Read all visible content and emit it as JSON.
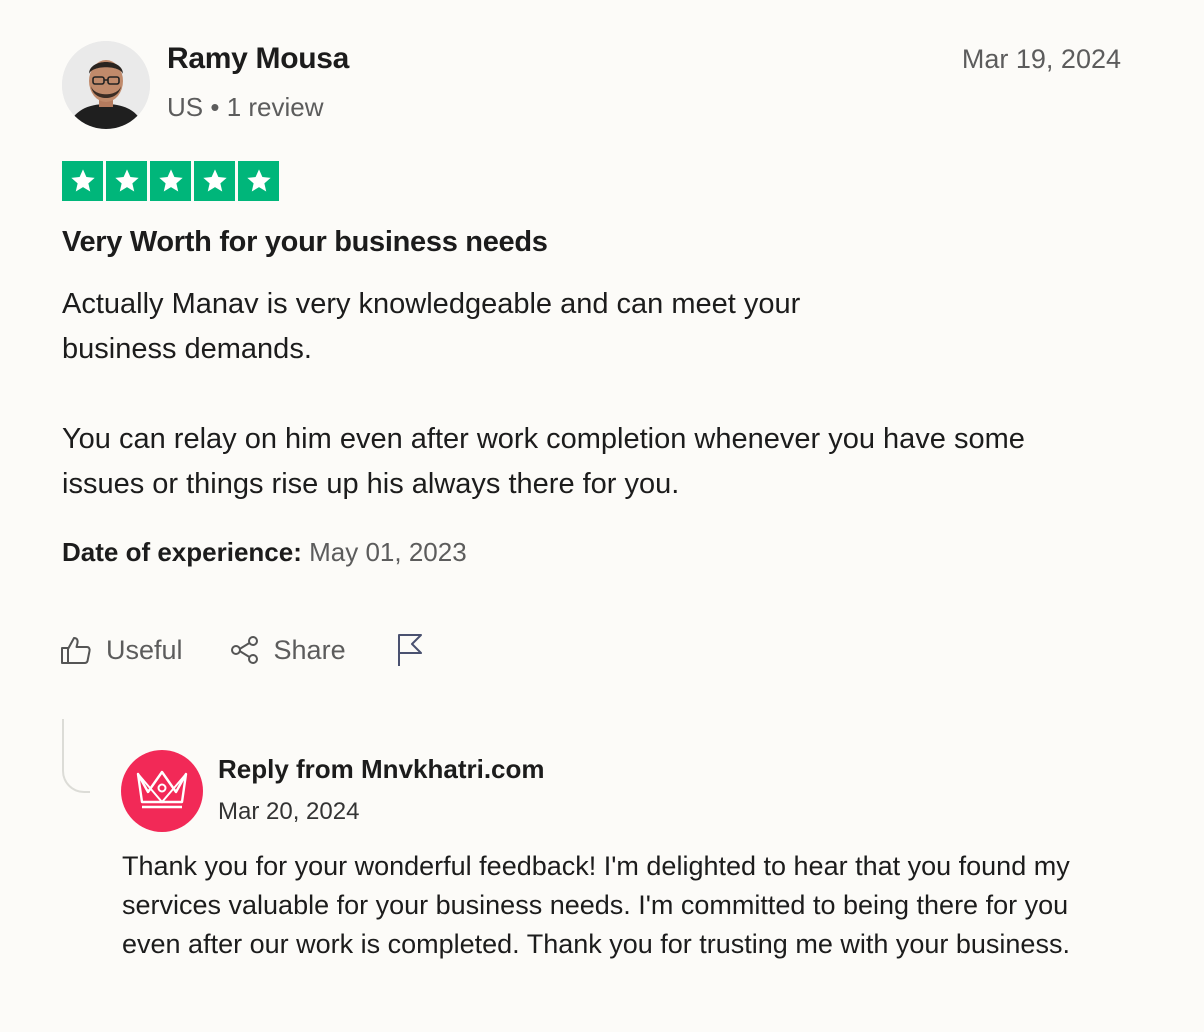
{
  "reviewer": {
    "name": "Ramy Mousa",
    "country": "US",
    "separator": "•",
    "review_count": "1 review",
    "avatar_icon": "person-avatar-icon"
  },
  "review": {
    "date": "Mar 19, 2024",
    "rating": 5,
    "rating_max": 5,
    "star_color": "#00b67a",
    "title": "Very Worth for your business needs",
    "body_paragraph_1": "Actually Manav is very knowledgeable and can meet your business demands.",
    "body_paragraph_2": "You can relay on him even after work completion whenever you have some issues or things rise up his always there for you.",
    "experience_label": "Date of experience:",
    "experience_date": "May 01, 2023"
  },
  "actions": {
    "useful_label": "Useful",
    "share_label": "Share",
    "useful_icon": "thumbs-up-icon",
    "share_icon": "share-icon",
    "report_icon": "flag-icon"
  },
  "reply": {
    "from_label": "Reply from Mnvkhatri.com",
    "date": "Mar 20, 2024",
    "logo_color": "#f22957",
    "logo_icon": "crown-icon",
    "body": "Thank you for your wonderful feedback! I'm delighted to hear that you found my services valuable for your business needs. I'm committed to being there for you even after our work is completed. Thank you for trusting me with your business."
  }
}
